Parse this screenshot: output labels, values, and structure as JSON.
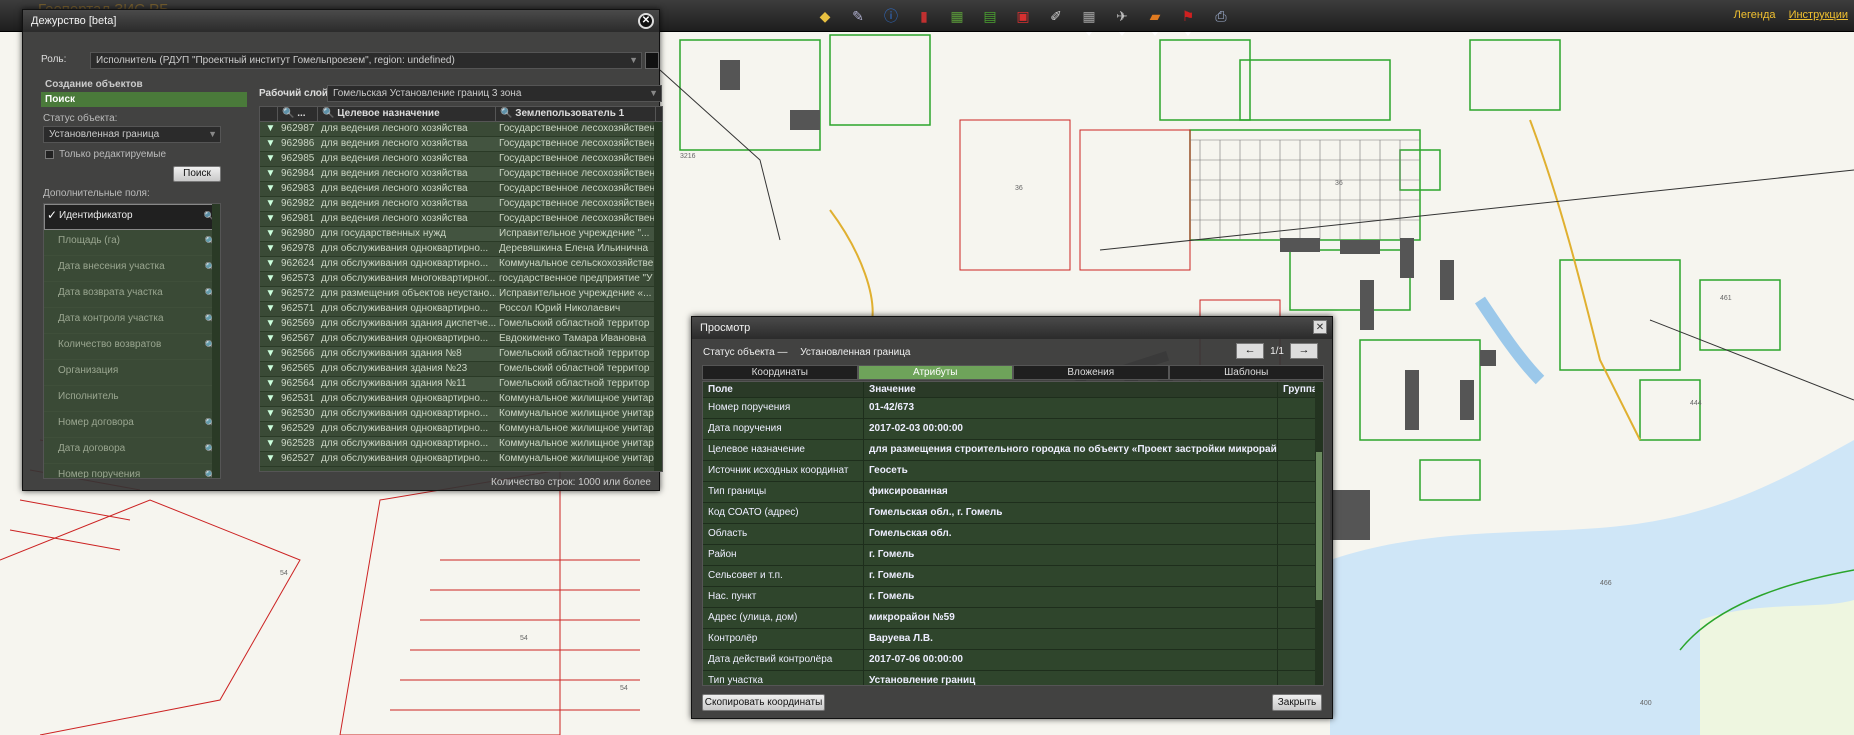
{
  "app": {
    "title": "Геопортал ЗИС РБ",
    "top_links": [
      "Легенда",
      "Инструкции"
    ]
  },
  "toolbar": {
    "tools": [
      {
        "icon": "layers-icon",
        "color": "#e8c040"
      },
      {
        "icon": "pencil-icon",
        "color": "#b0b0d0"
      },
      {
        "icon": "info-icon",
        "color": "#3070d0"
      },
      {
        "icon": "book-icon",
        "color": "#c03030"
      },
      {
        "icon": "map-book-icon",
        "color": "#5a9a3a"
      },
      {
        "icon": "map-icon",
        "color": "#4aa030"
      },
      {
        "icon": "gift-icon",
        "color": "#d83030"
      },
      {
        "icon": "edit-doc-icon",
        "color": "#d0d0d0"
      },
      {
        "icon": "grid-icon",
        "color": "#a0a0a0"
      },
      {
        "icon": "measure-icon",
        "color": "#c0c0c0"
      },
      {
        "icon": "book-orange-icon",
        "color": "#e07a20"
      },
      {
        "icon": "flag-icon",
        "color": "#d02020"
      },
      {
        "icon": "print-icon",
        "color": "#a0b0d0"
      }
    ]
  },
  "duty": {
    "title": "Дежурство [beta]",
    "role_label": "Роль:",
    "role_value": "Исполнитель (РДУП \"Проектный институт Гомельпроезем\", region: undefined)",
    "modes": [
      "Создание объектов",
      "Поиск"
    ],
    "status_label": "Статус объекта:",
    "status_value": "Установленная граница",
    "only_editable": "Только редактируемые",
    "search_button": "Поиск",
    "extra_fields_label": "Дополнительные поля:",
    "extra_fields": [
      {
        "label": "Идентификатор",
        "selected": true,
        "searchable": true
      },
      {
        "label": "Площадь (га)",
        "selected": false,
        "searchable": true
      },
      {
        "label": "Дата внесения участка",
        "selected": false,
        "searchable": true
      },
      {
        "label": "Дата возврата участка",
        "selected": false,
        "searchable": true
      },
      {
        "label": "Дата контроля участка",
        "selected": false,
        "searchable": true
      },
      {
        "label": "Количество возвратов",
        "selected": false,
        "searchable": true
      },
      {
        "label": "Организация",
        "selected": false,
        "searchable": false
      },
      {
        "label": "Исполнитель",
        "selected": false,
        "searchable": false
      },
      {
        "label": "Номер договора",
        "selected": false,
        "searchable": true
      },
      {
        "label": "Дата договора",
        "selected": false,
        "searchable": true
      },
      {
        "label": "Номер поручения",
        "selected": false,
        "searchable": true
      }
    ],
    "layer_label": "Рабочий слой:",
    "layer_value": "Гомельская Установление границ 3 зона",
    "grid_headers": [
      "",
      "...",
      "Целевое назначение",
      "Землепользователь 1"
    ],
    "grid_rows": [
      [
        "962987",
        "для ведения лесного хозяйства",
        "Государственное лесохозяйствен"
      ],
      [
        "962986",
        "для ведения лесного хозяйства",
        "Государственное лесохозяйствен"
      ],
      [
        "962985",
        "для ведения лесного хозяйства",
        "Государственное лесохозяйствен"
      ],
      [
        "962984",
        "для ведения лесного хозяйства",
        "Государственное лесохозяйствен"
      ],
      [
        "962983",
        "для ведения лесного хозяйства",
        "Государственное лесохозяйствен"
      ],
      [
        "962982",
        "для ведения лесного хозяйства",
        "Государственное лесохозяйствен"
      ],
      [
        "962981",
        "для ведения лесного хозяйства",
        "Государственное лесохозяйствен"
      ],
      [
        "962980",
        "для государственных нужд",
        "Исправительное учреждение \"..."
      ],
      [
        "962978",
        "для обслуживания одноквартирно...",
        "Деревяшкина Елена Ильинична"
      ],
      [
        "962624",
        "для обслуживания одноквартирно...",
        "Коммунальное сельскохозяйстве"
      ],
      [
        "962573",
        "для обслуживания многоквартирног...",
        "государственное предприятие \"У"
      ],
      [
        "962572",
        "для размещения объектов неустано...",
        "Исправительное учреждение «..."
      ],
      [
        "962571",
        "для обслуживания одноквартирно...",
        "Россол Юрий Николаевич"
      ],
      [
        "962569",
        "для обслуживания здания диспетче...",
        "Гомельский областной территор"
      ],
      [
        "962567",
        "для обслуживания одноквартирно...",
        "Евдокименко Тамара Ивановна"
      ],
      [
        "962566",
        "для обслуживания здания №8",
        "Гомельский областной территор"
      ],
      [
        "962565",
        "для обслуживания здания №23",
        "Гомельский областной территор"
      ],
      [
        "962564",
        "для обслуживания здания №11",
        "Гомельский областной территор"
      ],
      [
        "962531",
        "для обслуживания одноквартирно...",
        "Коммунальное жилищное унитар"
      ],
      [
        "962530",
        "для обслуживания одноквартирно...",
        "Коммунальное жилищное унитар"
      ],
      [
        "962529",
        "для обслуживания одноквартирно...",
        "Коммунальное жилищное унитар"
      ],
      [
        "962528",
        "для обслуживания одноквартирно...",
        "Коммунальное жилищное унитар"
      ],
      [
        "962527",
        "для обслуживания одноквартирно...",
        "Коммунальное жилищное унитар"
      ]
    ],
    "row_count": "Количество строк: 1000 или более"
  },
  "view": {
    "title": "Просмотр",
    "status_label": "Статус объекта —",
    "status_value": "Установленная граница",
    "pager": "1/1",
    "tabs": [
      "Координаты",
      "Атрибуты",
      "Вложения",
      "Шаблоны"
    ],
    "active_tab": 1,
    "headers": [
      "Поле",
      "Значение",
      "Группа"
    ],
    "rows": [
      [
        "Номер поручения",
        "01-42/673"
      ],
      [
        "Дата поручения",
        "2017-02-03 00:00:00"
      ],
      [
        "Целевое назначение",
        "для размещения строительного городка по объекту «Проект застройки микрорайона ..."
      ],
      [
        "Источник исходных координат",
        "Геосеть"
      ],
      [
        "Тип границы",
        "фиксированная"
      ],
      [
        "Код СОАТО (адрес)",
        "Гомельская обл., г. Гомель"
      ],
      [
        "Область",
        "Гомельская обл."
      ],
      [
        "Район",
        "г. Гомель"
      ],
      [
        "Сельсовет и т.п.",
        "г. Гомель"
      ],
      [
        "Нас. пункт",
        "г. Гомель"
      ],
      [
        "Адрес (улица, дом)",
        "микрорайон №59"
      ],
      [
        "Контролёр",
        "Варуева Л.В."
      ],
      [
        "Дата действий контролёра",
        "2017-07-06 00:00:00"
      ],
      [
        "Тип участка",
        "Установление границ"
      ]
    ],
    "copy_button": "Скопировать координаты",
    "close_button": "Закрыть"
  }
}
